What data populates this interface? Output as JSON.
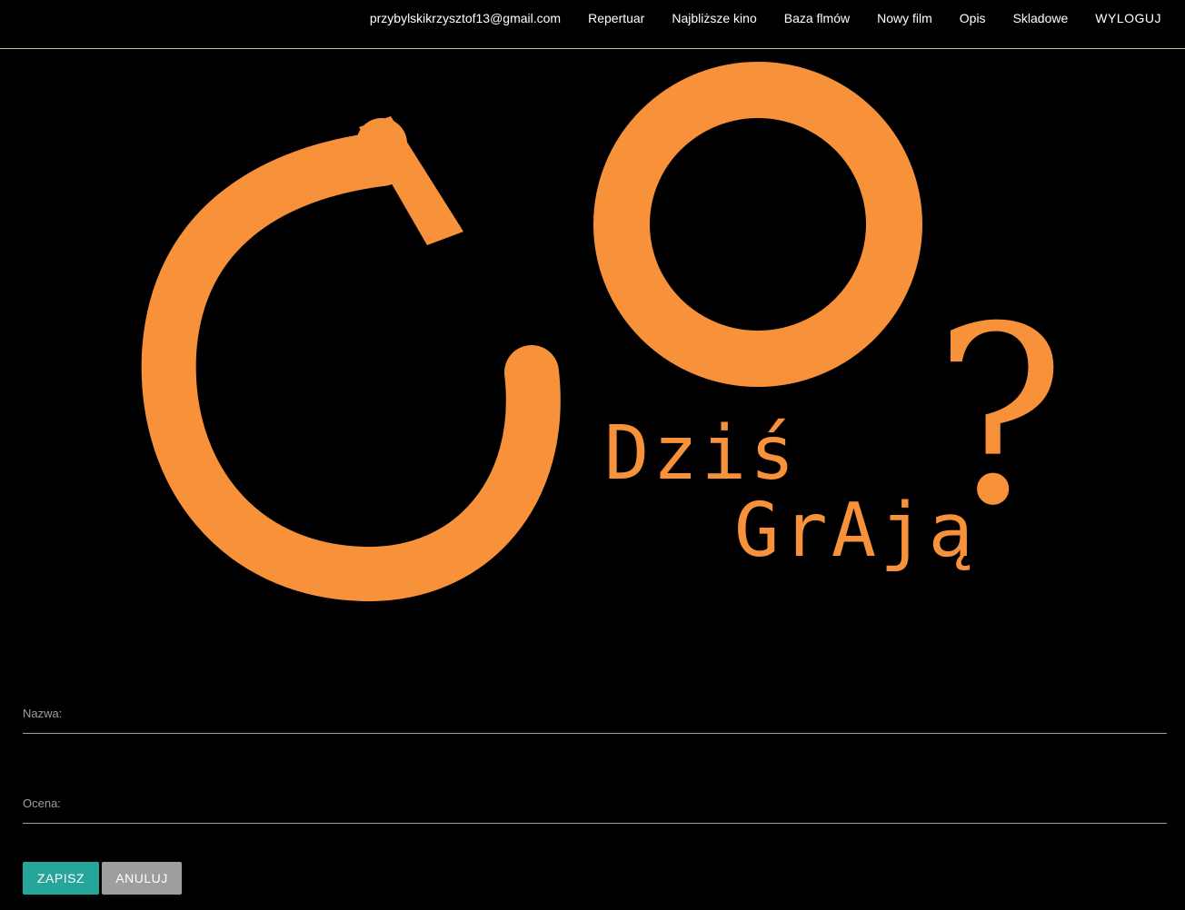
{
  "colors": {
    "accent": "#26a69a",
    "cancel": "#9e9e9e",
    "logo_orange": "#f7923a",
    "navbar_border": "#c9b98a"
  },
  "navbar": {
    "email": "przybylskikrzysztof13@gmail.com",
    "links": [
      "Repertuar",
      "Najbliższe kino",
      "Baza flmów",
      "Nowy film",
      "Opis",
      "Skladowe"
    ],
    "logout": "WYLOGUJ"
  },
  "logo": {
    "big_letters": "CO",
    "line1": "Dziś",
    "line2": "GrAją",
    "mark": "?"
  },
  "form": {
    "name_label": "Nazwa:",
    "name_value": "",
    "rating_label": "Ocena:",
    "rating_value": ""
  },
  "buttons": {
    "save": "ZAPISZ",
    "cancel": "ANULUJ"
  }
}
